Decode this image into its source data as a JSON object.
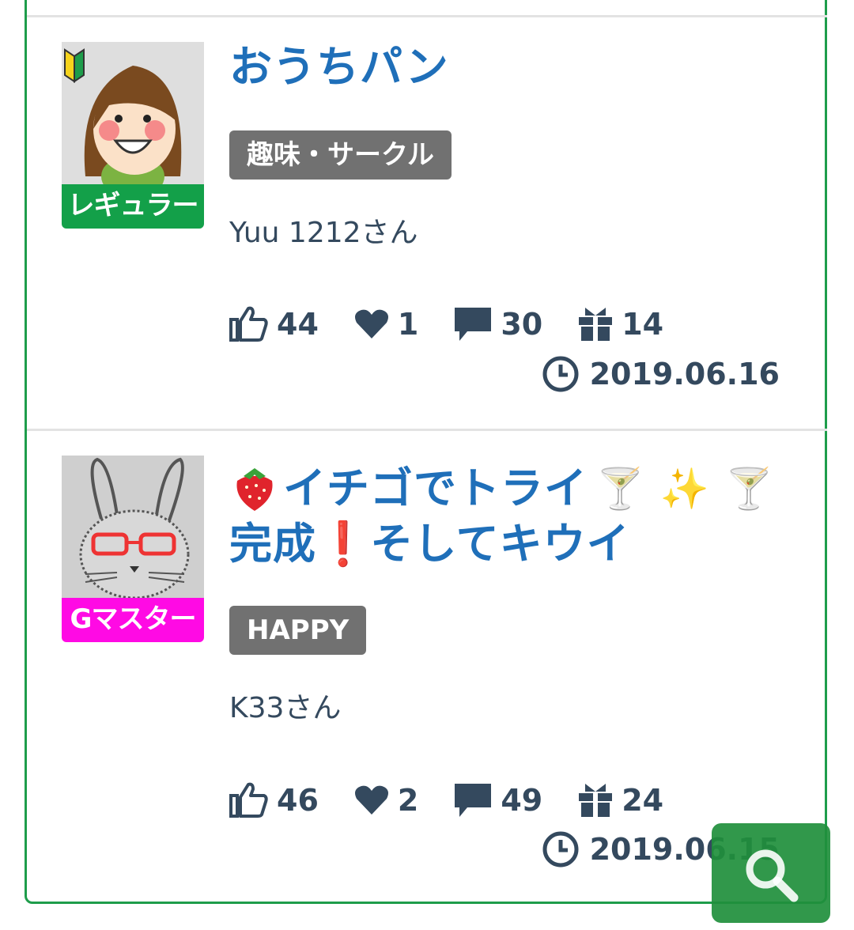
{
  "posts": [
    {
      "title": "おうちパン",
      "tag": "趣味・サークル",
      "author": "Yuu 1212さん",
      "rank": "レギュラー",
      "likes": "44",
      "hearts": "1",
      "comments": "30",
      "gifts": "14",
      "date": "2019.06.16"
    },
    {
      "title_line1": "イチゴでトライ",
      "title_emoji1": "🍸 ✨ 🍸",
      "title_line2a": "完成",
      "title_emoji2": "❗",
      "title_line2b": "そしてキウイ",
      "tag": "HAPPY",
      "author": "K33さん",
      "rank": "Gマスター",
      "likes": "46",
      "hearts": "2",
      "comments": "49",
      "gifts": "24",
      "date": "2019.06.15"
    }
  ],
  "colors": {
    "frame": "#1e9d4b",
    "title": "#1f6fb9",
    "rank_regular": "#13a049",
    "rank_master": "#ff0ae4",
    "tag": "#717171",
    "search_button": "#1f8f3c"
  },
  "icons": [
    "thumbs-up-icon",
    "heart-icon",
    "comment-icon",
    "gift-icon",
    "clock-icon",
    "search-icon",
    "beginner-mark-icon",
    "strawberry-icon"
  ]
}
